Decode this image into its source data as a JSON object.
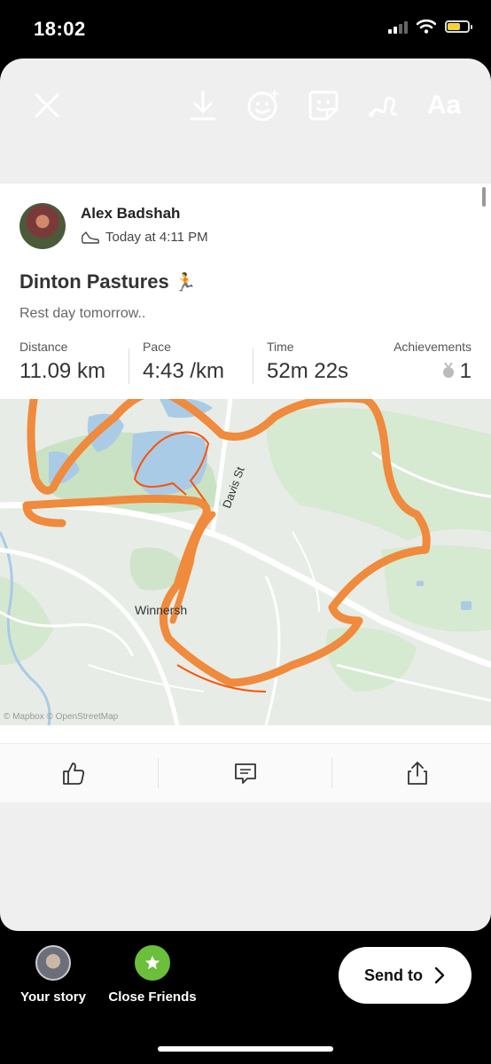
{
  "status_bar": {
    "time": "18:02"
  },
  "story_toolbar": {
    "text_tool_label": "Aa"
  },
  "activity": {
    "user_name": "Alex Badshah",
    "timestamp": "Today at 4:11 PM",
    "title": "Dinton Pastures",
    "title_emoji": "🏃",
    "description": "Rest day tomorrow..",
    "stats": [
      {
        "label": "Distance",
        "value": "11.09 km"
      },
      {
        "label": "Pace",
        "value": "4:43 /km"
      },
      {
        "label": "Time",
        "value": "52m 22s"
      },
      {
        "label": "Achievements",
        "value": "1"
      }
    ],
    "map": {
      "street_label": "Davis St",
      "place_label": "Winnersh",
      "attribution": "© Mapbox © OpenStreetMap",
      "route_color": "#fc5200",
      "drawing_color": "#f08a3c"
    }
  },
  "bottom_bar": {
    "your_story_label": "Your story",
    "close_friends_label": "Close Friends",
    "send_to_label": "Send to"
  }
}
